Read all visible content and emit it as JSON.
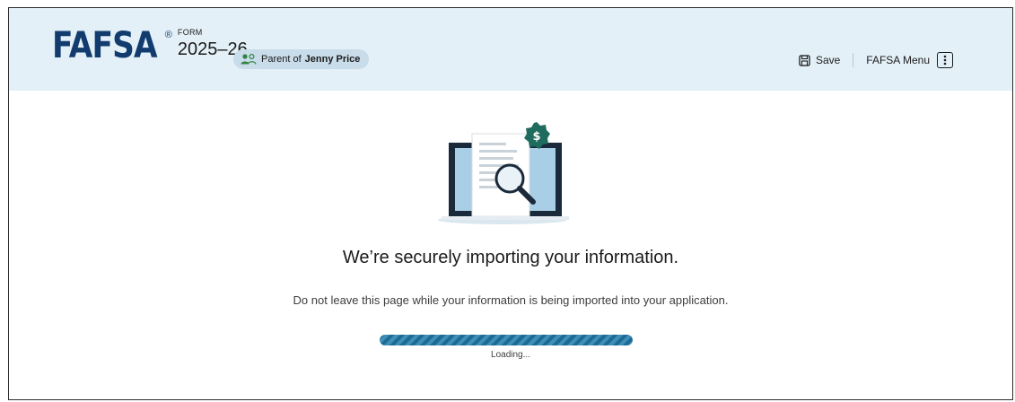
{
  "header": {
    "logo_text": "FAFSA",
    "logo_mark": "®",
    "form_label": "FORM",
    "form_year": "2025–26",
    "role": {
      "prefix": "Parent of",
      "name": "Jenny Price",
      "icon": "people-icon"
    },
    "save_label": "Save",
    "save_icon": "save-icon",
    "menu_label": "FAFSA Menu",
    "menu_icon": "kebab-menu-icon"
  },
  "main": {
    "illustration_icon": "laptop-search-dollar-icon",
    "heading": "We’re securely importing your information.",
    "subtext": "Do not leave this page while your information is being imported into your application.",
    "loading_label": "Loading...",
    "progress_fraction": 1.0
  },
  "colors": {
    "header_bg": "#e3f0f8",
    "brand": "#123c6e",
    "accent_green": "#1f6b5d",
    "progress": "#1d6a94"
  }
}
